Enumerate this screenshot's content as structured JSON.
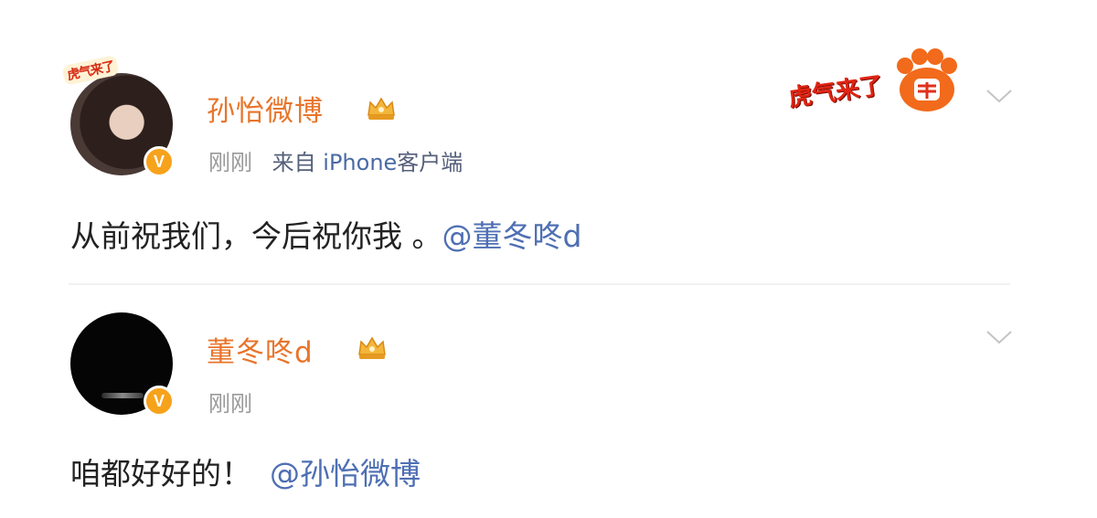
{
  "posts": [
    {
      "author": "孙怡微博",
      "time": "刚刚",
      "source_prefix": "来自",
      "source_device": "iPhone",
      "source_suffix": "客户端",
      "content_text": "从前祝我们，今后祝你我 。",
      "mention": "@董冬咚d",
      "badge": "V",
      "avatar_frame_text": "虎气来了",
      "sticker_text": "虎气来了"
    },
    {
      "author": "董冬咚d",
      "time": "刚刚",
      "content_text": "咱都好好的！",
      "mention": "@孙怡微博",
      "badge": "V"
    }
  ],
  "colors": {
    "name": "#e8752b",
    "mention": "#4e6fb3",
    "meta": "#999999",
    "verified_badge": "#f7a21b"
  },
  "icons": [
    "crown-icon",
    "chevron-down-icon",
    "verified-badge-icon",
    "tiger-paw-icon"
  ]
}
